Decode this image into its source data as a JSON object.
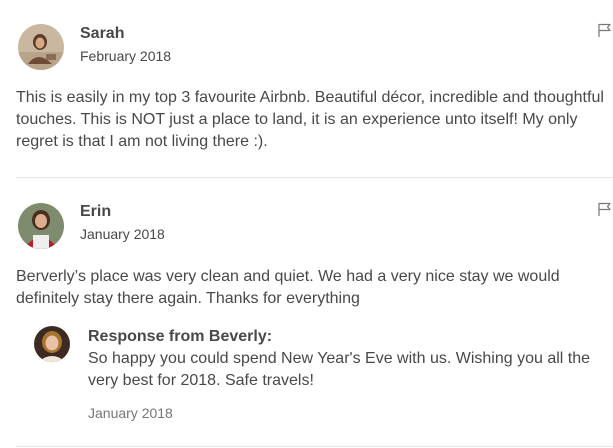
{
  "reviews": [
    {
      "name": "Sarah",
      "date": "February 2018",
      "text": "This is easily in my top 3 favourite Airbnb. Beautiful décor, incredible and thoughtful touches. This is NOT just a place to land, it is an experience unto itself! My only regret is that I am not living there :).",
      "flag_icon": "flag-icon"
    },
    {
      "name": "Erin",
      "date": "January 2018",
      "text": "Berverly’s place was very clean and quiet. We had a very nice stay we would definitely stay there again. Thanks for everything",
      "flag_icon": "flag-icon",
      "response": {
        "title": "Response from Beverly:",
        "text": "So happy you could spend New Year's Eve with us. Wishing you all the very best for 2018. Safe travels!",
        "date": "January 2018"
      }
    }
  ],
  "colors": {
    "text": "#484848",
    "muted": "#767676",
    "divider": "#e4e4e4"
  }
}
